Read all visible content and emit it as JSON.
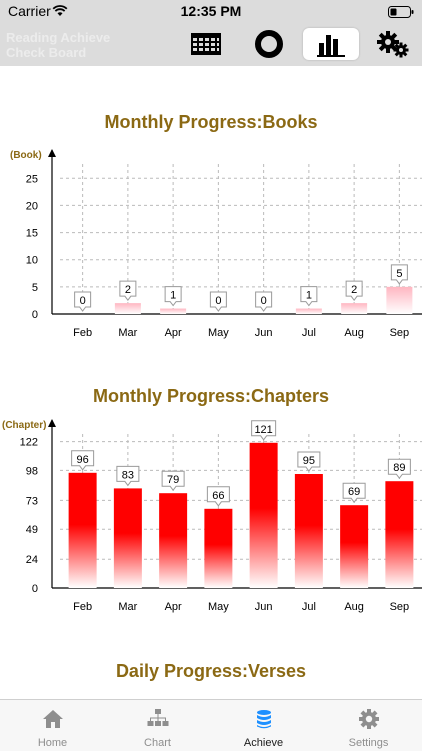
{
  "status": {
    "carrier": "Carrier",
    "time": "12:35 PM"
  },
  "app": {
    "title_line1": "Reading Achieve",
    "title_line2": "Check Board"
  },
  "toolbar": {
    "items": [
      "calendar-icon",
      "ring-icon",
      "bar-chart-icon",
      "gears-icon"
    ],
    "active_index": 2
  },
  "colors": {
    "accent_title": "#8b6914",
    "bar_red": "#ff0000",
    "chart_pink": "#ffb6c1"
  },
  "charts": [
    {
      "title": "Monthly Progress:Books"
    },
    {
      "title": "Monthly Progress:Chapters"
    },
    {
      "title": "Daily Progress:Verses"
    }
  ],
  "chart_data": [
    {
      "type": "bar",
      "title": "Monthly Progress:Books",
      "ylabel": "(Book)",
      "categories": [
        "Feb",
        "Mar",
        "Apr",
        "May",
        "Jun",
        "Jul",
        "Aug",
        "Sep"
      ],
      "values": [
        0,
        2,
        1,
        0,
        0,
        1,
        2,
        5
      ],
      "yticks": [
        0,
        5,
        10,
        15,
        20,
        25
      ],
      "ylim": [
        0,
        28
      ],
      "grid": true
    },
    {
      "type": "bar",
      "title": "Monthly Progress:Chapters",
      "ylabel": "(Chapter)",
      "categories": [
        "Feb",
        "Mar",
        "Apr",
        "May",
        "Jun",
        "Jul",
        "Aug",
        "Sep"
      ],
      "values": [
        96,
        83,
        79,
        66,
        121,
        95,
        69,
        89
      ],
      "yticks": [
        0,
        24,
        49,
        73,
        98,
        122
      ],
      "ylim": [
        0,
        130
      ],
      "grid": true
    }
  ],
  "tabs": [
    {
      "label": "Home",
      "icon": "home-icon"
    },
    {
      "label": "Chart",
      "icon": "org-chart-icon"
    },
    {
      "label": "Achieve",
      "icon": "database-icon"
    },
    {
      "label": "Settings",
      "icon": "settings-gear-icon"
    }
  ],
  "active_tab": 2
}
